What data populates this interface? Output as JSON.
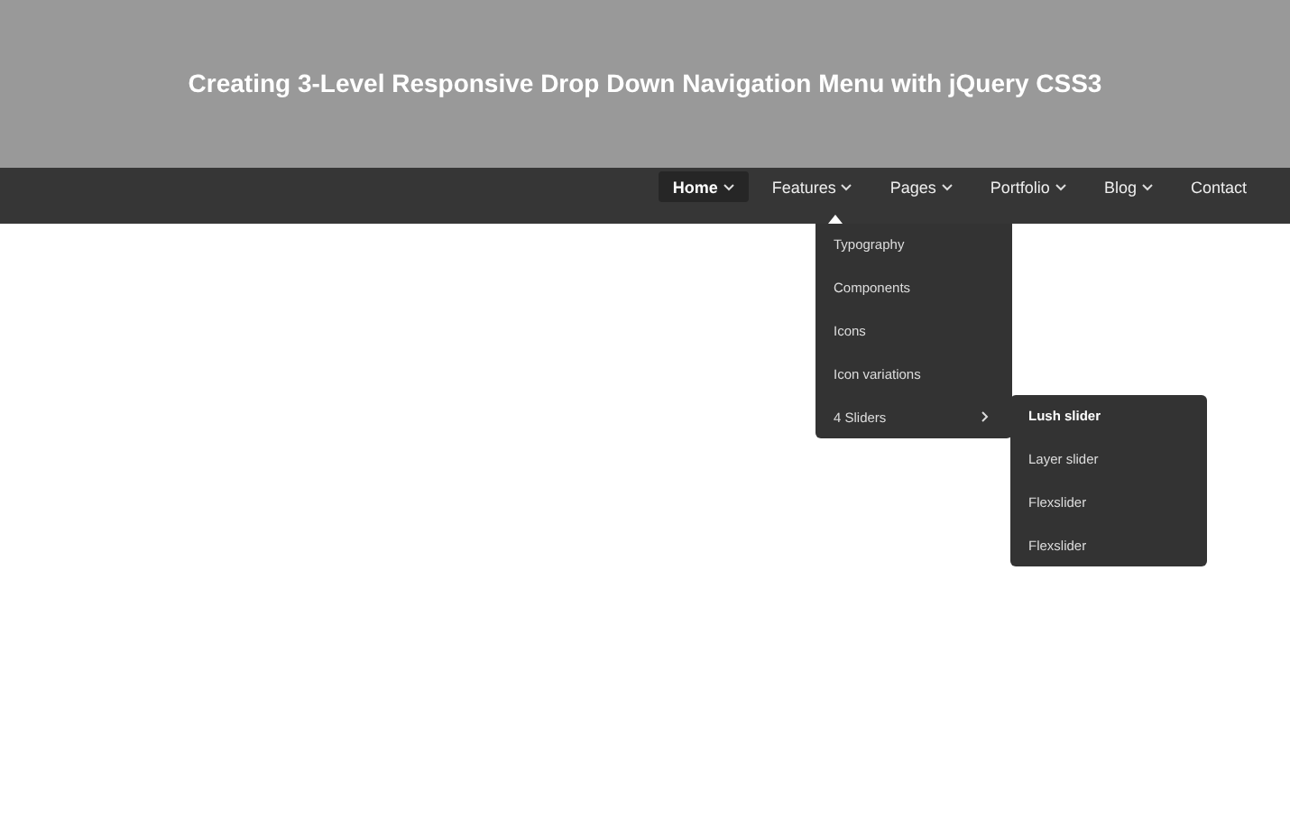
{
  "header": {
    "title": "Creating 3-Level Responsive Drop Down Navigation Menu with jQuery CSS3"
  },
  "nav": {
    "items": [
      {
        "label": "Home",
        "selected": true,
        "has_dropdown": true
      },
      {
        "label": "Features",
        "selected": false,
        "has_dropdown": true
      },
      {
        "label": "Pages",
        "selected": false,
        "has_dropdown": true
      },
      {
        "label": "Portfolio",
        "selected": false,
        "has_dropdown": true
      },
      {
        "label": "Blog",
        "selected": false,
        "has_dropdown": true
      },
      {
        "label": "Contact",
        "selected": false,
        "has_dropdown": false
      }
    ]
  },
  "dropdown": {
    "items": [
      {
        "label": "Typography",
        "has_submenu": false
      },
      {
        "label": "Components",
        "has_submenu": false
      },
      {
        "label": "Icons",
        "has_submenu": false
      },
      {
        "label": "Icon variations",
        "has_submenu": false
      },
      {
        "label": "4 Sliders",
        "has_submenu": true
      }
    ]
  },
  "submenu": {
    "items": [
      {
        "label": "Lush slider",
        "selected": true
      },
      {
        "label": "Layer slider",
        "selected": false
      },
      {
        "label": "Flexslider",
        "selected": false
      },
      {
        "label": "Flexslider",
        "selected": false
      }
    ]
  }
}
